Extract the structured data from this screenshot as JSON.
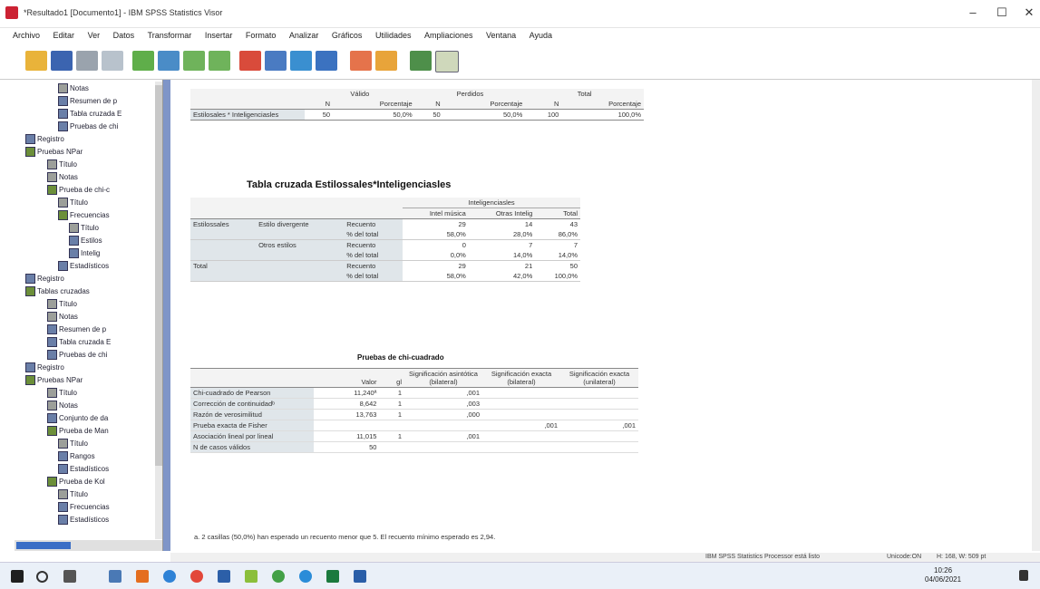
{
  "window": {
    "title": "*Resultado1 [Documento1] - IBM SPSS Statistics Visor"
  },
  "menu": [
    "Archivo",
    "Editar",
    "Ver",
    "Datos",
    "Transformar",
    "Insertar",
    "Formato",
    "Analizar",
    "Gráficos",
    "Utilidades",
    "Ampliaciones",
    "Ventana",
    "Ayuda"
  ],
  "nav": [
    {
      "indent": 4,
      "icon": "note",
      "label": "Notas"
    },
    {
      "indent": 4,
      "icon": "table",
      "label": "Resumen de p"
    },
    {
      "indent": 4,
      "icon": "table",
      "label": "Tabla cruzada E"
    },
    {
      "indent": 4,
      "icon": "table",
      "label": "Pruebas de chi"
    },
    {
      "indent": 1,
      "icon": "log",
      "label": "Registro"
    },
    {
      "indent": 1,
      "icon": "book",
      "label": "Pruebas NPar"
    },
    {
      "indent": 3,
      "icon": "note",
      "label": "Título"
    },
    {
      "indent": 3,
      "icon": "note",
      "label": "Notas"
    },
    {
      "indent": 3,
      "icon": "book",
      "label": "Prueba de chi-c"
    },
    {
      "indent": 4,
      "icon": "note",
      "label": "Título"
    },
    {
      "indent": 4,
      "icon": "book",
      "label": "Frecuencias"
    },
    {
      "indent": 5,
      "icon": "note",
      "label": "Título"
    },
    {
      "indent": 5,
      "icon": "table",
      "label": "Estilos"
    },
    {
      "indent": 5,
      "icon": "table",
      "label": "Intelig"
    },
    {
      "indent": 4,
      "icon": "table",
      "label": "Estadísticos"
    },
    {
      "indent": 1,
      "icon": "log",
      "label": "Registro"
    },
    {
      "indent": 1,
      "icon": "book",
      "label": "Tablas cruzadas"
    },
    {
      "indent": 3,
      "icon": "note",
      "label": "Título"
    },
    {
      "indent": 3,
      "icon": "note",
      "label": "Notas"
    },
    {
      "indent": 3,
      "icon": "table",
      "label": "Resumen de p"
    },
    {
      "indent": 3,
      "icon": "table",
      "label": "Tabla cruzada E"
    },
    {
      "indent": 3,
      "icon": "table",
      "label": "Pruebas de chi"
    },
    {
      "indent": 1,
      "icon": "log",
      "label": "Registro"
    },
    {
      "indent": 1,
      "icon": "book",
      "label": "Pruebas NPar"
    },
    {
      "indent": 3,
      "icon": "note",
      "label": "Título"
    },
    {
      "indent": 3,
      "icon": "note",
      "label": "Notas"
    },
    {
      "indent": 3,
      "icon": "table",
      "label": "Conjunto de da"
    },
    {
      "indent": 3,
      "icon": "book",
      "label": "Prueba de Man"
    },
    {
      "indent": 4,
      "icon": "note",
      "label": "Título"
    },
    {
      "indent": 4,
      "icon": "table",
      "label": "Rangos"
    },
    {
      "indent": 4,
      "icon": "table",
      "label": "Estadísticos"
    },
    {
      "indent": 3,
      "icon": "book",
      "label": "Prueba de Kol"
    },
    {
      "indent": 4,
      "icon": "note",
      "label": "Título"
    },
    {
      "indent": 4,
      "icon": "table",
      "label": "Frecuencias"
    },
    {
      "indent": 4,
      "icon": "table",
      "label": "Estadísticos"
    }
  ],
  "summary": {
    "groups": [
      "Válido",
      "Perdidos",
      "Total"
    ],
    "sub": [
      "N",
      "Porcentaje",
      "N",
      "Porcentaje",
      "N",
      "Porcentaje"
    ],
    "rowlabel": "Estilosales * Inteligenciasles",
    "values": [
      "50",
      "50,0%",
      "50",
      "50,0%",
      "100",
      "100,0%"
    ]
  },
  "crosstab": {
    "title": "Tabla cruzada Estilossales*Inteligenciasles",
    "colgroup": "Inteligenciasles",
    "cols": [
      "Intel música",
      "Otras Intelig",
      "Total"
    ],
    "rows": [
      {
        "a": "Estilossales",
        "b": "Estilo divergente",
        "c": "Recuento",
        "v": [
          "29",
          "14",
          "43"
        ]
      },
      {
        "a": "",
        "b": "",
        "c": "% del total",
        "v": [
          "58,0%",
          "28,0%",
          "86,0%"
        ]
      },
      {
        "a": "",
        "b": "Otros estilos",
        "c": "Recuento",
        "v": [
          "0",
          "7",
          "7"
        ]
      },
      {
        "a": "",
        "b": "",
        "c": "% del total",
        "v": [
          "0,0%",
          "14,0%",
          "14,0%"
        ]
      },
      {
        "a": "Total",
        "b": "",
        "c": "Recuento",
        "v": [
          "29",
          "21",
          "50"
        ]
      },
      {
        "a": "",
        "b": "",
        "c": "% del total",
        "v": [
          "58,0%",
          "42,0%",
          "100,0%"
        ]
      }
    ]
  },
  "chisq": {
    "title": "Pruebas de chi-cuadrado",
    "headers": [
      "",
      "Valor",
      "gl",
      "Significación asintótica (bilateral)",
      "Significación exacta (bilateral)",
      "Significación exacta (unilateral)"
    ],
    "rows": [
      [
        "Chi-cuadrado de Pearson",
        "11,240ª",
        "1",
        ",001",
        "",
        ""
      ],
      [
        "Corrección de continuidadᵇ",
        "8,642",
        "1",
        ",003",
        "",
        ""
      ],
      [
        "Razón de verosimilitud",
        "13,763",
        "1",
        ",000",
        "",
        ""
      ],
      [
        "Prueba exacta de Fisher",
        "",
        "",
        "",
        ",001",
        ",001"
      ],
      [
        "Asociación lineal por lineal",
        "11,015",
        "1",
        ",001",
        "",
        ""
      ],
      [
        "N de casos válidos",
        "50",
        "",
        "",
        "",
        ""
      ]
    ],
    "footnote": "a. 2 casillas (50,0%) han esperado un recuento menor que 5. El recuento mínimo esperado es 2,94."
  },
  "status": {
    "processor": "IBM SPSS Statistics Processor está listo",
    "encoding": "Unicode:ON",
    "size": "H: 168, W: 509 pt"
  },
  "taskbar": {
    "time": "10:26",
    "date": "04/06/2021"
  }
}
